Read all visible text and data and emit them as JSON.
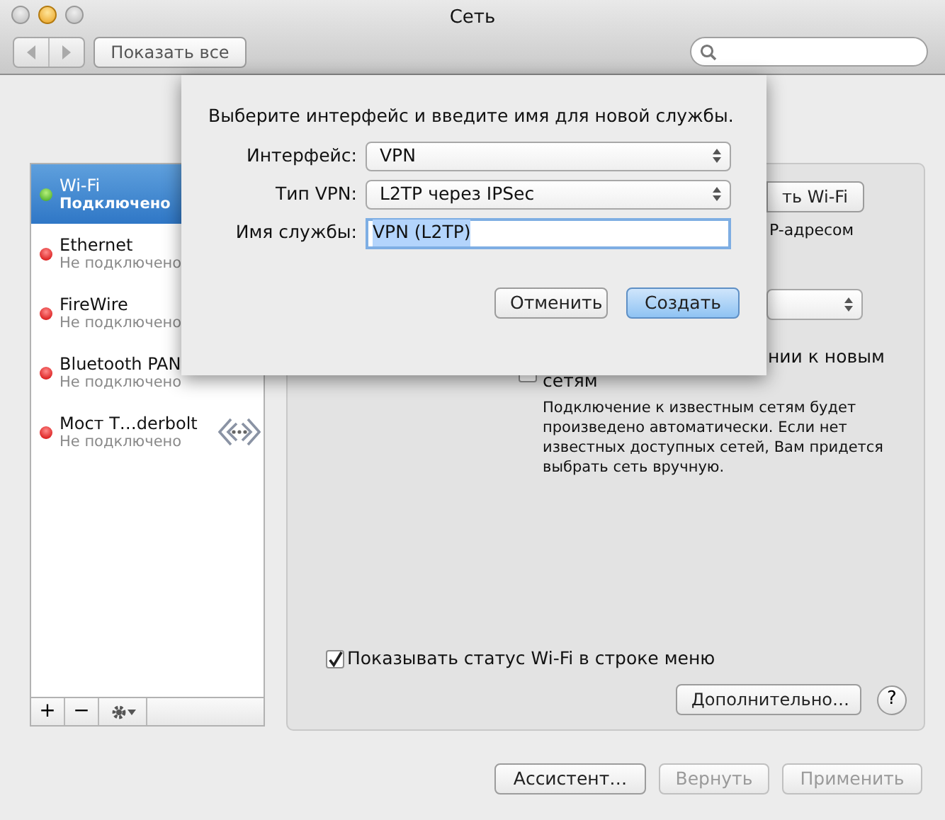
{
  "window": {
    "title": "Сеть"
  },
  "toolbar": {
    "show_all_button": "Показать все"
  },
  "services": [
    {
      "name": "Wi-Fi",
      "status": "Подключено",
      "connected": true,
      "selected": true,
      "kind": "plain"
    },
    {
      "name": "Ethernet",
      "status": "Не подключено",
      "connected": false,
      "selected": false,
      "kind": "plain"
    },
    {
      "name": "FireWire",
      "status": "Не подключено",
      "connected": false,
      "selected": false,
      "kind": "plain"
    },
    {
      "name": "Bluetooth PAN",
      "status": "Не подключено",
      "connected": false,
      "selected": false,
      "kind": "plain"
    },
    {
      "name": "Мост T…derbolt",
      "status": "Не подключено",
      "connected": false,
      "selected": false,
      "kind": "thunderbolt"
    }
  ],
  "list_actions": [
    "+",
    "−"
  ],
  "dialog": {
    "prompt": "Выберите интерфейс и введите имя для новой службы.",
    "fields": [
      {
        "kind": "select",
        "label": "Интерфейс:",
        "value": "VPN"
      },
      {
        "kind": "select",
        "label": "Тип VPN:",
        "value": "L2TP через IPSec"
      },
      {
        "kind": "text",
        "label": "Имя службы:",
        "value": "VPN (L2TP)",
        "text_selected": true
      }
    ],
    "buttons": [
      {
        "label": "Отменить",
        "default": false
      },
      {
        "label": "Создать",
        "default": true
      }
    ]
  },
  "detail": {
    "partial_button": "ть Wi-Fi",
    "partial_status": "P-адресом",
    "ask_new_networks": {
      "label": "нии к новым сетям",
      "checked": false
    },
    "note": "Подключение к известным сетям будет произведено автоматически. Если нет известных доступных сетей, Вам придется выбрать сеть вручную.",
    "show_status": {
      "label": "Показывать статус Wi-Fi в строке меню",
      "checked": true
    },
    "advanced_button": "Дополнительно…",
    "help": "?"
  },
  "footer_buttons": [
    {
      "label": "Ассистент…",
      "disabled": false
    },
    {
      "label": "Вернуть",
      "disabled": true
    },
    {
      "label": "Применить",
      "disabled": true
    }
  ]
}
